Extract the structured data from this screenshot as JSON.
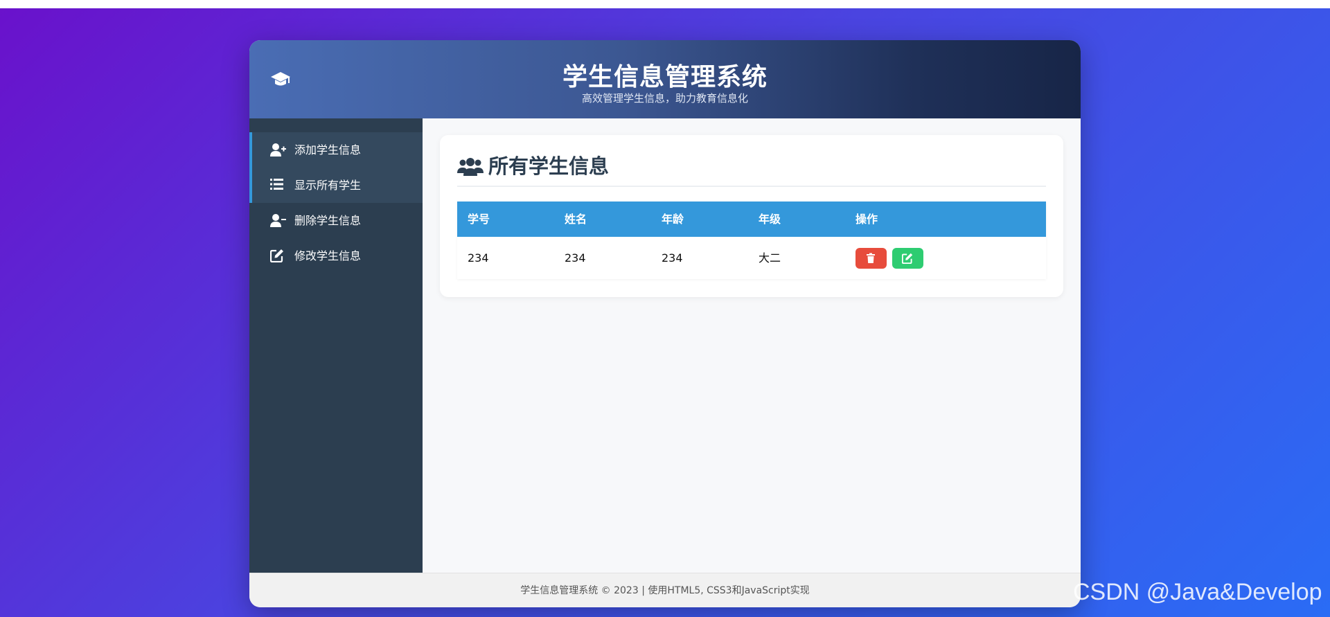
{
  "header": {
    "title": "学生信息管理系统",
    "subtitle": "高效管理学生信息，助力教育信息化",
    "logo_icon": "graduation-cap-icon"
  },
  "sidebar": {
    "items": [
      {
        "label": "添加学生信息",
        "icon": "user-plus-icon",
        "active": true
      },
      {
        "label": "显示所有学生",
        "icon": "list-icon",
        "active": true
      },
      {
        "label": "删除学生信息",
        "icon": "user-minus-icon",
        "active": false
      },
      {
        "label": "修改学生信息",
        "icon": "edit-icon",
        "active": false
      }
    ]
  },
  "main": {
    "title": "所有学生信息",
    "title_icon": "users-icon",
    "table": {
      "headers": [
        "学号",
        "姓名",
        "年龄",
        "年级",
        "操作"
      ],
      "rows": [
        {
          "id": "234",
          "name": "234",
          "age": "234",
          "grade": "大二"
        }
      ],
      "actions": [
        {
          "icon": "trash-icon",
          "color": "#e74c3c"
        },
        {
          "icon": "edit-icon",
          "color": "#2ecc71"
        }
      ]
    }
  },
  "footer": {
    "text": "学生信息管理系统 © 2023 | 使用HTML5, CSS3和JavaScript实现"
  },
  "watermark": "CSDN @Java&Develop",
  "colors": {
    "accent": "#3498db",
    "sidebar_bg": "#2c3e50",
    "danger": "#e74c3c",
    "success": "#2ecc71"
  }
}
